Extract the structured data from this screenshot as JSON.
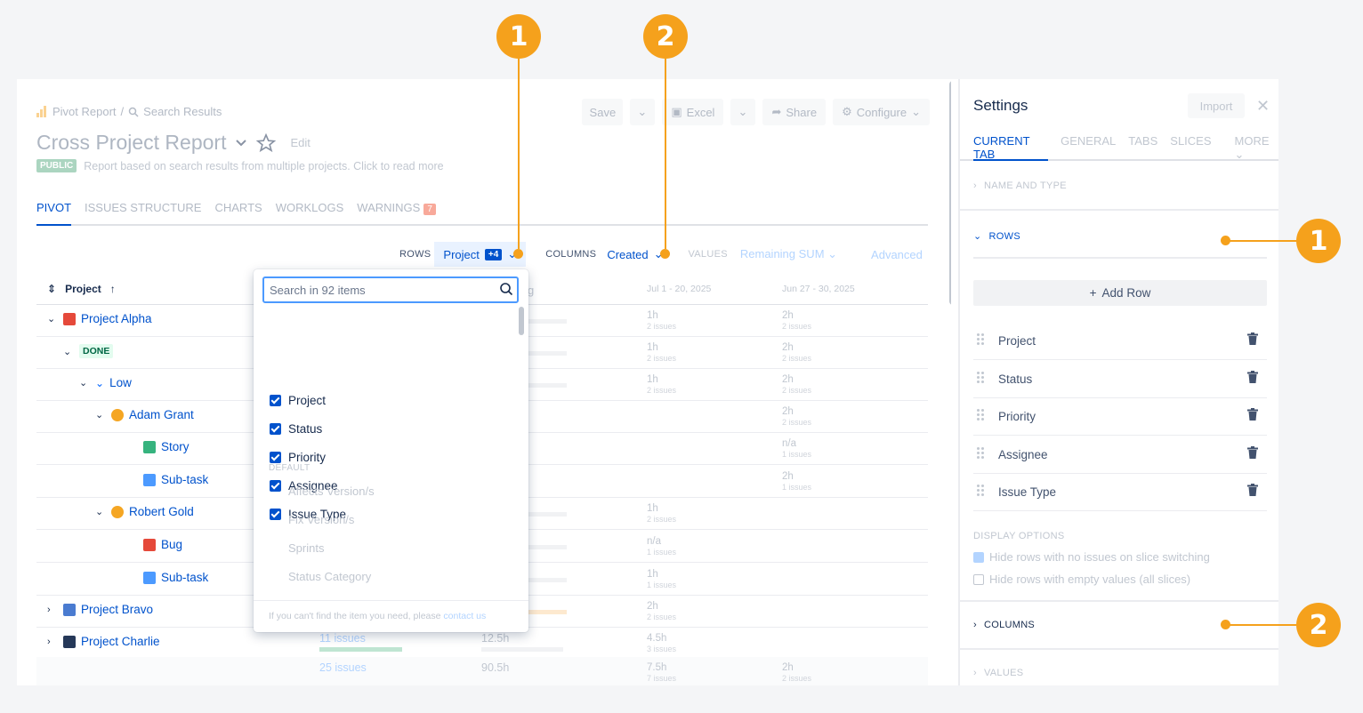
{
  "report": {
    "breadcrumb": {
      "root": "Pivot Report",
      "sep": "/",
      "current": "Search Results"
    },
    "toolbar": {
      "save": "Save",
      "excel": "Excel",
      "share": "Share",
      "configure": "Configure"
    },
    "title": "Cross Project Report",
    "edit": "Edit",
    "public_badge": "PUBLIC",
    "description": "Report based on search results from multiple projects. Click to read more",
    "tabs": [
      "PIVOT",
      "ISSUES STRUCTURE",
      "CHARTS",
      "WORKLOGS",
      "WARNINGS"
    ],
    "warnings_count": "7",
    "rows_label": "ROWS",
    "rows_value": "Project",
    "rows_extra": "+4",
    "columns_label": "COLUMNS",
    "columns_value": "Created",
    "values_label": "VALUES",
    "values_value": "Remaining SUM",
    "advanced": "Advanced",
    "grid_header": {
      "project": "Project",
      "col3_partial": "g",
      "date1": "Jul 1 - 20, 2025",
      "date2": "Jun 27 - 30, 2025"
    },
    "tree": [
      {
        "label": "Project Alpha",
        "level": 0,
        "icon": "project-alpha-icon",
        "expanded": true
      },
      {
        "label": "DONE",
        "level": 1,
        "icon": "status-lozenge",
        "expanded": true
      },
      {
        "label": "Low",
        "level": 2,
        "icon": "priority-low-icon",
        "expanded": true
      },
      {
        "label": "Adam Grant",
        "level": 3,
        "icon": "avatar-icon",
        "expanded": true
      },
      {
        "label": "Story",
        "level": 4,
        "icon": "story-icon"
      },
      {
        "label": "Sub-task",
        "level": 4,
        "icon": "subtask-icon"
      },
      {
        "label": "Robert Gold",
        "level": 3,
        "icon": "avatar-icon",
        "expanded": true
      },
      {
        "label": "Bug",
        "level": 4,
        "icon": "bug-icon"
      },
      {
        "label": "Sub-task",
        "level": 4,
        "icon": "subtask-icon"
      },
      {
        "label": "Project Bravo",
        "level": 0,
        "icon": "project-bravo-icon",
        "expanded": false
      },
      {
        "label": "Project Charlie",
        "level": 0,
        "icon": "project-charlie-icon",
        "expanded": false
      }
    ],
    "cells": {
      "c1": [
        {
          "v": "1h",
          "s": "2 issues"
        },
        {
          "v": "1h",
          "s": "2 issues"
        },
        {
          "v": "1h",
          "s": "2 issues"
        },
        {
          "v": "",
          "s": ""
        },
        {
          "v": "",
          "s": ""
        },
        {
          "v": "",
          "s": ""
        },
        {
          "v": "1h",
          "s": "2 issues"
        },
        {
          "v": "n/a",
          "s": "1 issues"
        },
        {
          "v": "1h",
          "s": "1 issues"
        },
        {
          "v": "2h",
          "s": "2 issues"
        },
        {
          "v": "4.5h",
          "s": "3 issues"
        },
        {
          "v": "7.5h",
          "s": "7 issues"
        }
      ],
      "c2": [
        {
          "v": "2h",
          "s": "2 issues"
        },
        {
          "v": "2h",
          "s": "2 issues"
        },
        {
          "v": "2h",
          "s": "2 issues"
        },
        {
          "v": "2h",
          "s": "2 issues"
        },
        {
          "v": "n/a",
          "s": "1 issues"
        },
        {
          "v": "2h",
          "s": "1 issues"
        },
        {
          "v": "",
          "s": ""
        },
        {
          "v": "",
          "s": ""
        },
        {
          "v": "",
          "s": ""
        },
        {
          "v": "",
          "s": ""
        },
        {
          "v": "",
          "s": ""
        },
        {
          "v": "2h",
          "s": "2 issues"
        }
      ],
      "charlie_issues": "11 issues",
      "charlie_hours": "12.5h",
      "total_issues": "25 issues",
      "total_hours": "90.5h"
    }
  },
  "dropdown": {
    "search_placeholder": "Search in 92 items",
    "checked": [
      "Project",
      "Status",
      "Priority",
      "Assignee",
      "Issue Type"
    ],
    "section": "DEFAULT",
    "unchecked": [
      "Affects Version/s",
      "Fix Version/s",
      "Sprints",
      "Status Category"
    ],
    "footer_text": "If you can't find the item you need, please",
    "footer_link": "contact us"
  },
  "settings": {
    "title": "Settings",
    "import": "Import",
    "tabs": [
      "CURRENT TAB",
      "GENERAL",
      "TABS",
      "SLICES",
      "MORE"
    ],
    "name_and_type": "NAME AND TYPE",
    "rows_section": "ROWS",
    "add_row": "Add Row",
    "row_items": [
      "Project",
      "Status",
      "Priority",
      "Assignee",
      "Issue Type"
    ],
    "display_options": "DISPLAY OPTIONS",
    "opt1": "Hide rows with no issues on slice switching",
    "opt2": "Hide rows with empty values (all slices)",
    "columns_section": "COLUMNS",
    "values_section": "VALUES"
  },
  "callouts": {
    "one": "1",
    "two": "2"
  },
  "colors": {
    "accent": "#0052cc",
    "callout": "#f5a11c",
    "done_text": "#006644"
  }
}
